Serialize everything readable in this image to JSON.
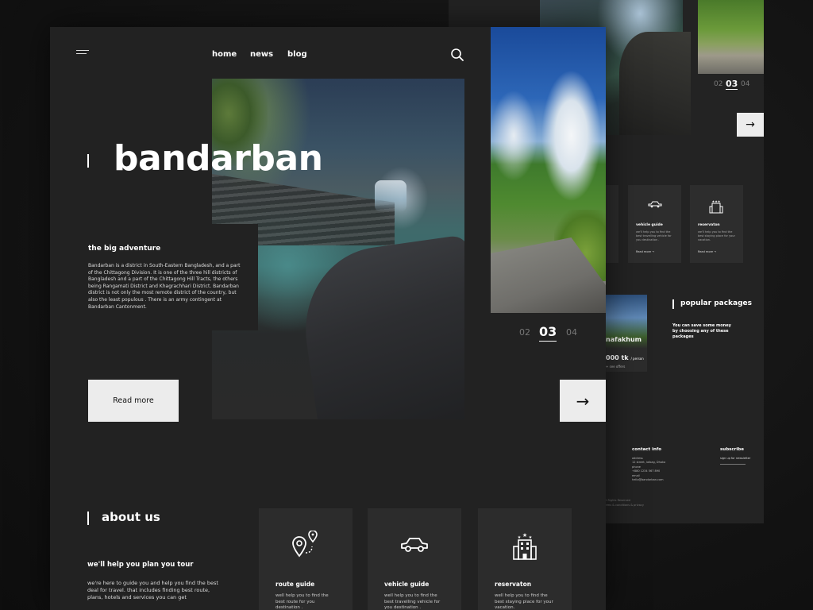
{
  "back_page": {
    "pager": {
      "prev": "02",
      "current": "03",
      "next": "04"
    },
    "arrow": "→",
    "services": [
      {
        "icon": "car-icon",
        "glyph": "🚗",
        "title": "vehicle guide",
        "desc": "we'll help you to find the best travelling vehicle for you destination .",
        "link": "Read more →"
      },
      {
        "icon": "hotel-icon",
        "glyph": "🏨",
        "title": "reservaton",
        "desc": "we'll help you to find the best staying place for your vacation.",
        "link": "Read more →"
      }
    ],
    "package": {
      "name": "nafakhum",
      "price": "000 tk",
      "unit": "/ person",
      "extra": "+ see offers"
    },
    "popular": {
      "title": "popular packages",
      "desc": "You can save some money by choosing any of these packages"
    },
    "contact": {
      "title": "contact info",
      "lines": [
        "address",
        "12 street, lalbag, Dhaka",
        "phone",
        "+880 1234 567 890",
        "email",
        "hello@bandarban.com"
      ]
    },
    "subscribe": {
      "title": "subscribe",
      "desc": "sign up for newsletter"
    },
    "copyright": [
      "All Rights Reserved",
      "terms & conditions & privacy"
    ]
  },
  "front_page": {
    "nav": [
      "home",
      "news",
      "blog"
    ],
    "hero": {
      "title": "bandarban",
      "subtitle": "the big adventure",
      "description": "Bandarban  is a district in South-Eastern Bangladesh, and a part of the Chittagong Division. It is one of the three hill districts of Bangladesh and a part of the Chittagong Hill Tracts, the others being Rangamati District and Khagrachhari District. Bandarban district is not only the most remote district of the country, but also the least populous . There is an army contingent at Bandarban Cantonment.",
      "read_more": "Read more",
      "arrow": "→"
    },
    "pager": {
      "prev": "02",
      "current": "03",
      "next": "04"
    },
    "about": {
      "title": "about us",
      "subtitle": "we'll help you plan you tour",
      "desc": "we're here to guide you and help you find the best deal for travel. that includes finding best route, plans, hotels and services you can get"
    },
    "services": [
      {
        "icon": "route-icon",
        "title": "route guide",
        "desc": "well help you to find the best route for you destination ."
      },
      {
        "icon": "car-icon",
        "title": "vehicle guide",
        "desc": "well help you to find the best travelling vehicle for you destination ."
      },
      {
        "icon": "hotel-icon",
        "title": "reservaton",
        "desc": "well help you to find the best staying place for your vacation."
      }
    ]
  }
}
